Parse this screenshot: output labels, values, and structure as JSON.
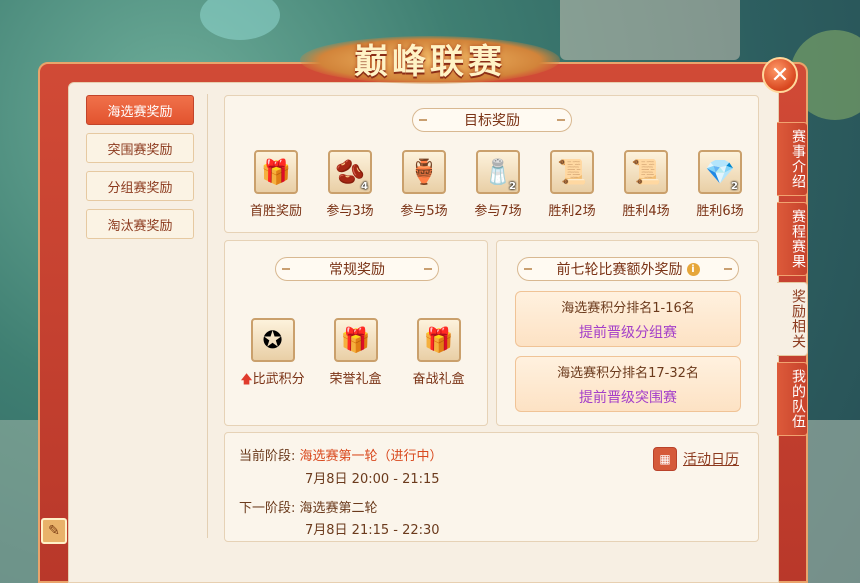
{
  "title": "巅峰联赛",
  "left_nav": [
    {
      "label": "海选赛奖励",
      "active": true
    },
    {
      "label": "突围赛奖励",
      "active": false
    },
    {
      "label": "分组赛奖励",
      "active": false
    },
    {
      "label": "淘汰赛奖励",
      "active": false
    }
  ],
  "right_tabs": [
    {
      "label": "赛事介绍",
      "active": false
    },
    {
      "label": "赛程赛果",
      "active": false
    },
    {
      "label": "奖励相关",
      "active": true
    },
    {
      "label": "我的队伍",
      "active": false
    }
  ],
  "target_rewards": {
    "title": "目标奖励",
    "items": [
      {
        "label": "首胜奖励",
        "icon": "gift-box-icon",
        "glyph": "🎁",
        "count": ""
      },
      {
        "label": "参与3场",
        "icon": "beans-icon",
        "glyph": "🫘",
        "count": "4"
      },
      {
        "label": "参与5场",
        "icon": "potion-vase-icon",
        "glyph": "🏺",
        "count": ""
      },
      {
        "label": "参与7场",
        "icon": "salt-pile-icon",
        "glyph": "🧂",
        "count": "2"
      },
      {
        "label": "胜利2场",
        "icon": "scroll-icon",
        "glyph": "📜",
        "count": ""
      },
      {
        "label": "胜利4场",
        "icon": "golden-scroll-icon",
        "glyph": "📜",
        "count": ""
      },
      {
        "label": "胜利6场",
        "icon": "crystal-icon",
        "glyph": "💎",
        "count": "2"
      }
    ]
  },
  "normal_rewards": {
    "title": "常规奖励",
    "items": [
      {
        "label": "比武积分",
        "icon": "medal-coin-icon",
        "glyph": "✪",
        "arrow": "🡅"
      },
      {
        "label": "荣誉礼盒",
        "icon": "honor-gift-icon",
        "glyph": "🎁",
        "arrow": ""
      },
      {
        "label": "奋战礼盒",
        "icon": "battle-gift-icon",
        "glyph": "🎁",
        "arrow": ""
      }
    ]
  },
  "extra_rewards": {
    "title": "前七轮比赛额外奖励",
    "info_glyph": "i",
    "cards": [
      {
        "rank": "海选赛积分排名1-16名",
        "desc": "提前晋级分组赛"
      },
      {
        "rank": "海选赛积分排名17-32名",
        "desc": "提前晋级突围赛"
      }
    ]
  },
  "stage": {
    "current_label": "当前阶段:",
    "current_value": "海选赛第一轮（进行中）",
    "current_time": "7月8日 20:00 - 21:15",
    "next_label": "下一阶段:",
    "next_value": "海选赛第二轮",
    "next_time": "7月8日 21:15 - 22:30"
  },
  "calendar_button": {
    "label": "活动日历",
    "glyph": "▦"
  },
  "close_glyph": "✕",
  "edit_glyph": "✎"
}
